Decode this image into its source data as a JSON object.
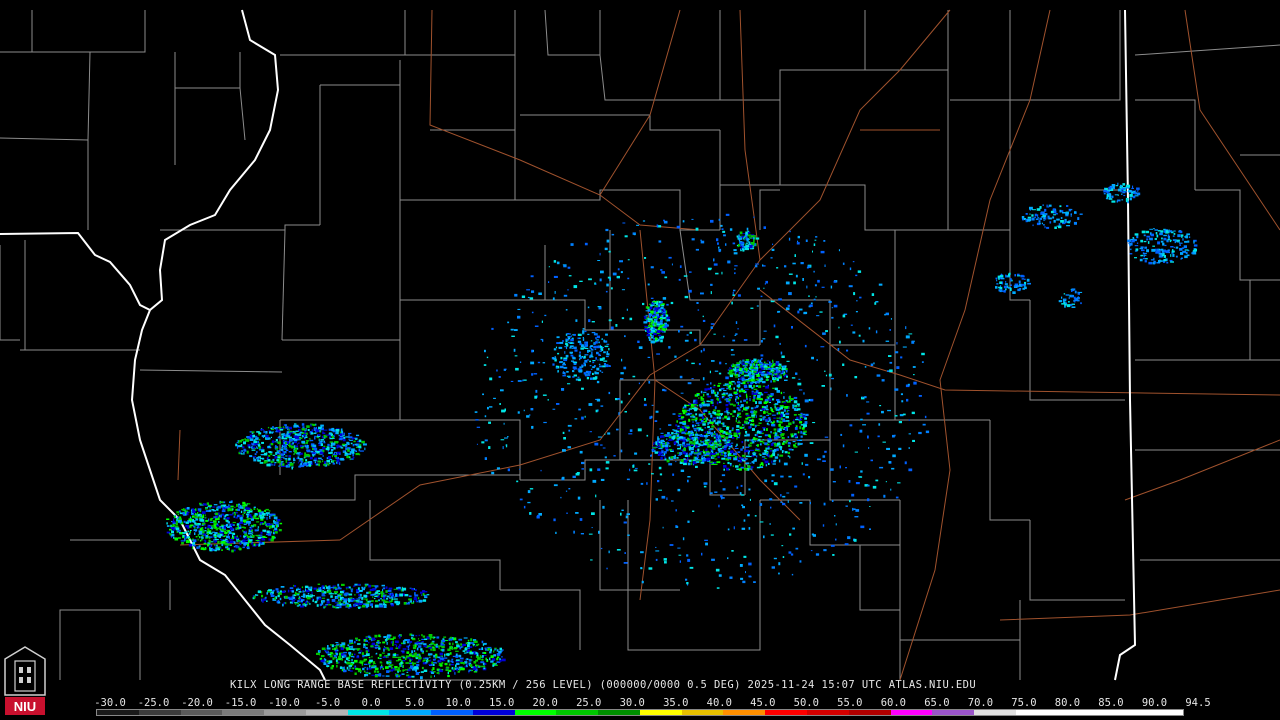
{
  "caption": "KILX LONG RANGE BASE REFLECTIVITY (0.25KM / 256 LEVEL) (000000/0000 0.5 DEG) 2025-11-24 15:07 UTC  ATLAS.NIU.EDU",
  "radar_site": "KILX",
  "product": "LONG RANGE BASE REFLECTIVITY",
  "timestamp": "2025-11-24 15:07 UTC",
  "source": "ATLAS.NIU.EDU",
  "logo_text": "NIU",
  "scale": {
    "labels": [
      "-30.0",
      "-25.0",
      "-20.0",
      "-15.0",
      "-10.0",
      "-5.0",
      "0.0",
      "5.0",
      "10.0",
      "15.0",
      "20.0",
      "25.0",
      "30.0",
      "35.0",
      "40.0",
      "45.0",
      "50.0",
      "55.0",
      "60.0",
      "65.0",
      "70.0",
      "75.0",
      "80.0",
      "85.0",
      "90.0",
      "94.5"
    ],
    "colors": [
      "#1a1a1a",
      "#3c3c3c",
      "#5a5a5a",
      "#7a7a7a",
      "#9a9a9a",
      "#b4b4b4",
      "#00e6e6",
      "#00aaff",
      "#0060ff",
      "#0000d8",
      "#00ff00",
      "#00c800",
      "#009000",
      "#ffff00",
      "#e6c000",
      "#ff9000",
      "#ff0000",
      "#d40000",
      "#b00000",
      "#ff00ff",
      "#9a55c9",
      "#e0e0e0",
      "#ffffff",
      "#ffffff",
      "#ffffff",
      "#ffffff"
    ]
  },
  "map_colors": {
    "county_lines": "#9a9a9a",
    "state_lines": "#ffffff",
    "highways": "#a0522d",
    "background": "#000000"
  }
}
